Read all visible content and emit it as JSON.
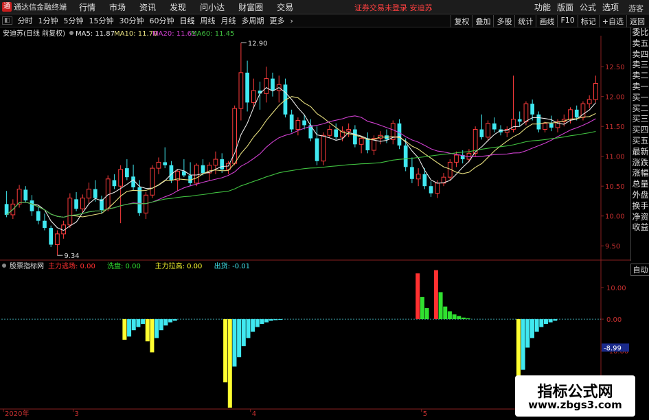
{
  "menubar": {
    "app_title": "通达信金融终端",
    "items": [
      "行情",
      "市场",
      "资讯",
      "发现",
      "问小达",
      "财富圈",
      "交易"
    ],
    "notice": "证券交易未登录  安迪苏",
    "right_items": [
      "功能",
      "版面",
      "公式",
      "选项"
    ],
    "guest": "游客"
  },
  "toolbar": {
    "periods": [
      "分时",
      "1分钟",
      "5分钟",
      "15分钟",
      "30分钟",
      "60分钟",
      "日线",
      "周线",
      "月线",
      "多周期",
      "更多"
    ],
    "right_buttons": [
      "复权",
      "叠加",
      "多股",
      "统计",
      "画线",
      "F10",
      "标记",
      "+自选",
      "返回"
    ]
  },
  "side_panel": {
    "items": [
      "委比",
      "卖五",
      "卖四",
      "卖三",
      "卖二",
      "卖一",
      "买一",
      "买二",
      "买三",
      "买四",
      "买五",
      "最新",
      "涨跌",
      "涨幅",
      "总量",
      "外盘",
      "换手",
      "净资",
      "收益"
    ],
    "auto_label": "自动"
  },
  "watermark": {
    "title": "指标公式网",
    "url": "www.zbgs3.com"
  },
  "chart_data": [
    {
      "type": "candlestick",
      "title": "安迪苏(日线 前复权)",
      "legend": [
        {
          "name": "MA5",
          "value": "11.87",
          "color": "#e8e8e8"
        },
        {
          "name": "MA10",
          "value": "11.70",
          "color": "#e8e080"
        },
        {
          "name": "MA20",
          "value": "11.61",
          "color": "#d040d0"
        },
        {
          "name": "MA60",
          "value": "11.45",
          "color": "#40c040"
        }
      ],
      "y_ticks": [
        12.5,
        12.0,
        11.5,
        11.0,
        10.5,
        10.0,
        9.5
      ],
      "ylim": [
        9.25,
        12.95
      ],
      "annotations": [
        {
          "label": "12.90",
          "value": 12.9
        },
        {
          "label": "9.34",
          "value": 9.34
        }
      ],
      "colors": {
        "up": "#ff3c3c",
        "down": "#40e8f0"
      },
      "candles": [
        [
          10.2,
          10.42,
          9.98,
          10.02
        ],
        [
          10.02,
          10.28,
          9.95,
          10.2
        ],
        [
          10.2,
          10.52,
          10.14,
          10.45
        ],
        [
          10.44,
          10.5,
          10.22,
          10.26
        ],
        [
          10.26,
          10.35,
          10.0,
          10.08
        ],
        [
          10.08,
          10.16,
          9.86,
          9.92
        ],
        [
          9.92,
          10.04,
          9.76,
          9.8
        ],
        [
          9.8,
          9.84,
          9.48,
          9.52
        ],
        [
          9.52,
          9.76,
          9.34,
          9.7
        ],
        [
          9.7,
          9.92,
          9.62,
          9.85
        ],
        [
          9.85,
          10.38,
          9.8,
          10.3
        ],
        [
          10.28,
          10.4,
          10.08,
          10.12
        ],
        [
          10.12,
          10.36,
          10.05,
          10.3
        ],
        [
          10.3,
          10.56,
          10.2,
          10.45
        ],
        [
          10.45,
          10.6,
          10.24,
          10.3
        ],
        [
          10.28,
          10.34,
          10.04,
          10.1
        ],
        [
          10.12,
          10.68,
          10.08,
          10.62
        ],
        [
          10.6,
          10.7,
          10.45,
          10.5
        ],
        [
          10.5,
          10.85,
          9.88,
          10.78
        ],
        [
          10.8,
          10.95,
          10.6,
          10.65
        ],
        [
          10.66,
          10.86,
          10.42,
          10.48
        ],
        [
          10.48,
          10.6,
          10.0,
          10.05
        ],
        [
          10.05,
          10.4,
          9.95,
          10.35
        ],
        [
          10.35,
          10.85,
          10.3,
          10.8
        ],
        [
          10.8,
          10.98,
          10.7,
          10.9
        ],
        [
          10.9,
          11.15,
          10.8,
          10.85
        ],
        [
          10.85,
          10.92,
          10.55,
          10.6
        ],
        [
          10.6,
          10.78,
          10.42,
          10.75
        ],
        [
          10.75,
          10.95,
          10.65,
          10.68
        ],
        [
          10.68,
          10.9,
          10.5,
          10.55
        ],
        [
          10.55,
          10.88,
          10.5,
          10.85
        ],
        [
          10.85,
          10.95,
          10.68,
          10.72
        ],
        [
          10.72,
          10.9,
          10.6,
          10.85
        ],
        [
          10.85,
          11.08,
          10.7,
          10.95
        ],
        [
          10.95,
          11.05,
          10.72,
          10.78
        ],
        [
          10.78,
          10.92,
          10.7,
          10.88
        ],
        [
          10.88,
          11.85,
          10.85,
          11.8
        ],
        [
          11.8,
          12.9,
          11.6,
          12.4
        ],
        [
          12.4,
          12.6,
          11.75,
          11.9
        ],
        [
          11.9,
          12.3,
          11.8,
          12.1
        ],
        [
          12.1,
          12.25,
          11.78,
          12.05
        ],
        [
          12.05,
          12.5,
          11.9,
          12.3
        ],
        [
          12.3,
          12.4,
          12.0,
          12.1
        ],
        [
          12.1,
          12.35,
          11.9,
          12.2
        ],
        [
          12.2,
          12.3,
          11.65,
          11.7
        ],
        [
          11.7,
          11.78,
          11.4,
          11.45
        ],
        [
          11.45,
          11.65,
          11.35,
          11.6
        ],
        [
          11.6,
          11.7,
          11.45,
          11.52
        ],
        [
          11.52,
          11.62,
          11.25,
          11.3
        ],
        [
          11.3,
          11.5,
          10.85,
          10.92
        ],
        [
          10.92,
          11.4,
          10.85,
          11.35
        ],
        [
          11.35,
          11.52,
          11.3,
          11.45
        ],
        [
          11.45,
          11.55,
          11.28,
          11.32
        ],
        [
          11.32,
          11.5,
          11.25,
          11.42
        ],
        [
          11.42,
          11.55,
          11.32,
          11.45
        ],
        [
          11.45,
          11.52,
          11.15,
          11.2
        ],
        [
          11.2,
          11.32,
          11.05,
          11.3
        ],
        [
          11.3,
          11.4,
          11.05,
          11.1
        ],
        [
          11.1,
          11.35,
          11.02,
          11.3
        ],
        [
          11.3,
          11.42,
          11.2,
          11.35
        ],
        [
          11.35,
          11.45,
          11.22,
          11.28
        ],
        [
          11.28,
          11.6,
          11.2,
          11.55
        ],
        [
          11.55,
          11.62,
          11.12,
          11.18
        ],
        [
          11.18,
          11.3,
          10.75,
          10.82
        ],
        [
          10.82,
          10.98,
          10.55,
          10.62
        ],
        [
          10.62,
          10.8,
          10.5,
          10.7
        ],
        [
          10.7,
          10.8,
          10.45,
          10.5
        ],
        [
          10.5,
          10.58,
          10.32,
          10.38
        ],
        [
          10.38,
          10.6,
          10.3,
          10.55
        ],
        [
          10.55,
          10.72,
          10.5,
          10.65
        ],
        [
          10.65,
          10.95,
          10.6,
          10.9
        ],
        [
          10.9,
          11.08,
          10.82,
          11.02
        ],
        [
          11.02,
          11.1,
          10.88,
          10.95
        ],
        [
          10.95,
          11.12,
          10.9,
          11.05
        ],
        [
          11.05,
          11.5,
          11.0,
          11.45
        ],
        [
          11.45,
          11.7,
          11.28,
          11.32
        ],
        [
          11.32,
          11.6,
          11.25,
          11.55
        ],
        [
          11.55,
          11.65,
          11.4,
          11.45
        ],
        [
          11.45,
          11.52,
          11.35,
          11.4
        ],
        [
          11.4,
          11.5,
          11.32,
          11.45
        ],
        [
          11.45,
          12.35,
          11.4,
          11.62
        ],
        [
          11.62,
          11.75,
          11.5,
          11.58
        ],
        [
          11.58,
          11.92,
          11.52,
          11.88
        ],
        [
          11.88,
          11.95,
          11.6,
          11.7
        ],
        [
          11.7,
          11.75,
          11.4,
          11.45
        ],
        [
          11.45,
          11.58,
          11.4,
          11.55
        ],
        [
          11.55,
          11.68,
          11.42,
          11.48
        ],
        [
          11.48,
          11.62,
          11.4,
          11.58
        ],
        [
          11.58,
          11.7,
          11.5,
          11.62
        ],
        [
          11.62,
          11.82,
          11.55,
          11.78
        ],
        [
          11.78,
          11.85,
          11.6,
          11.65
        ],
        [
          11.65,
          11.92,
          11.6,
          11.88
        ],
        [
          11.88,
          12.02,
          11.8,
          11.95
        ],
        [
          11.95,
          12.35,
          11.9,
          12.22
        ]
      ]
    },
    {
      "type": "bar",
      "title": "股票指标网",
      "legend": [
        {
          "name": "主力逃场",
          "value": "0.00",
          "color": "#ff3030"
        },
        {
          "name": "洗盘",
          "value": "0.00",
          "color": "#30e030"
        },
        {
          "name": "主力拉高",
          "value": "0.00",
          "color": "#ffff30"
        },
        {
          "name": "出货",
          "value": "-0.01",
          "color": "#40e8f0"
        }
      ],
      "y_ticks": [
        10.0,
        0.0,
        -10.0,
        -20.0
      ],
      "ylim": [
        -28.0,
        15.0
      ],
      "current_value_label": "-8.99",
      "current_value": -8.99,
      "bars": [
        {
          "index": 26,
          "value": -6.5,
          "color": "#ffff30"
        },
        {
          "index": 27,
          "value": -5.5,
          "color": "#40e8f0"
        },
        {
          "index": 28,
          "value": -3.5,
          "color": "#40e8f0"
        },
        {
          "index": 29,
          "value": -2.5,
          "color": "#40e8f0"
        },
        {
          "index": 30,
          "value": -1.5,
          "color": "#40e8f0"
        },
        {
          "index": 31,
          "value": -7.0,
          "color": "#ffff30"
        },
        {
          "index": 32,
          "value": -10.5,
          "color": "#ffff30"
        },
        {
          "index": 33,
          "value": -6.0,
          "color": "#40e8f0"
        },
        {
          "index": 34,
          "value": -3.5,
          "color": "#40e8f0"
        },
        {
          "index": 35,
          "value": -2.0,
          "color": "#40e8f0"
        },
        {
          "index": 36,
          "value": -1.0,
          "color": "#40e8f0"
        },
        {
          "index": 37,
          "value": -0.5,
          "color": "#40e8f0"
        },
        {
          "index": 48,
          "value": -20.0,
          "color": "#ffff30"
        },
        {
          "index": 49,
          "value": -28.0,
          "color": "#ffff30"
        },
        {
          "index": 50,
          "value": -15.0,
          "color": "#40e8f0"
        },
        {
          "index": 51,
          "value": -12.0,
          "color": "#40e8f0"
        },
        {
          "index": 52,
          "value": -8.5,
          "color": "#40e8f0"
        },
        {
          "index": 53,
          "value": -6.0,
          "color": "#40e8f0"
        },
        {
          "index": 54,
          "value": -4.0,
          "color": "#40e8f0"
        },
        {
          "index": 55,
          "value": -2.5,
          "color": "#40e8f0"
        },
        {
          "index": 56,
          "value": -1.5,
          "color": "#40e8f0"
        },
        {
          "index": 57,
          "value": -1.0,
          "color": "#40e8f0"
        },
        {
          "index": 58,
          "value": -0.5,
          "color": "#40e8f0"
        },
        {
          "index": 59,
          "value": -0.3,
          "color": "#40e8f0"
        },
        {
          "index": 60,
          "value": -0.2,
          "color": "#40e8f0"
        },
        {
          "index": 90,
          "value": 14.5,
          "color": "#ff3030"
        },
        {
          "index": 91,
          "value": 7.0,
          "color": "#30e030"
        },
        {
          "index": 92,
          "value": 3.5,
          "color": "#30e030"
        },
        {
          "index": 94,
          "value": 15.5,
          "color": "#ff3030"
        },
        {
          "index": 95,
          "value": 8.5,
          "color": "#30e030"
        },
        {
          "index": 96,
          "value": 4.0,
          "color": "#30e030"
        },
        {
          "index": 97,
          "value": 2.5,
          "color": "#30e030"
        },
        {
          "index": 98,
          "value": 1.5,
          "color": "#30e030"
        },
        {
          "index": 99,
          "value": 1.0,
          "color": "#30e030"
        },
        {
          "index": 100,
          "value": 0.5,
          "color": "#30e030"
        },
        {
          "index": 101,
          "value": 0.3,
          "color": "#30e030"
        },
        {
          "index": 112,
          "value": -20.0,
          "color": "#ffff30"
        },
        {
          "index": 113,
          "value": -16.0,
          "color": "#40e8f0"
        },
        {
          "index": 114,
          "value": -9.0,
          "color": "#40e8f0"
        },
        {
          "index": 115,
          "value": -6.0,
          "color": "#40e8f0"
        },
        {
          "index": 116,
          "value": -4.0,
          "color": "#40e8f0"
        },
        {
          "index": 117,
          "value": -2.5,
          "color": "#40e8f0"
        },
        {
          "index": 118,
          "value": -1.5,
          "color": "#40e8f0"
        },
        {
          "index": 119,
          "value": -1.0,
          "color": "#40e8f0"
        },
        {
          "index": 120,
          "value": -0.5,
          "color": "#40e8f0"
        }
      ],
      "bar_slots": 130
    }
  ],
  "x_axis": {
    "labels": [
      {
        "text": "2020年",
        "index": 0
      },
      {
        "text": "3",
        "index": 11
      },
      {
        "text": "4",
        "index": 39
      },
      {
        "text": "5",
        "index": 66
      },
      {
        "text": "6",
        "index": 88
      }
    ]
  }
}
